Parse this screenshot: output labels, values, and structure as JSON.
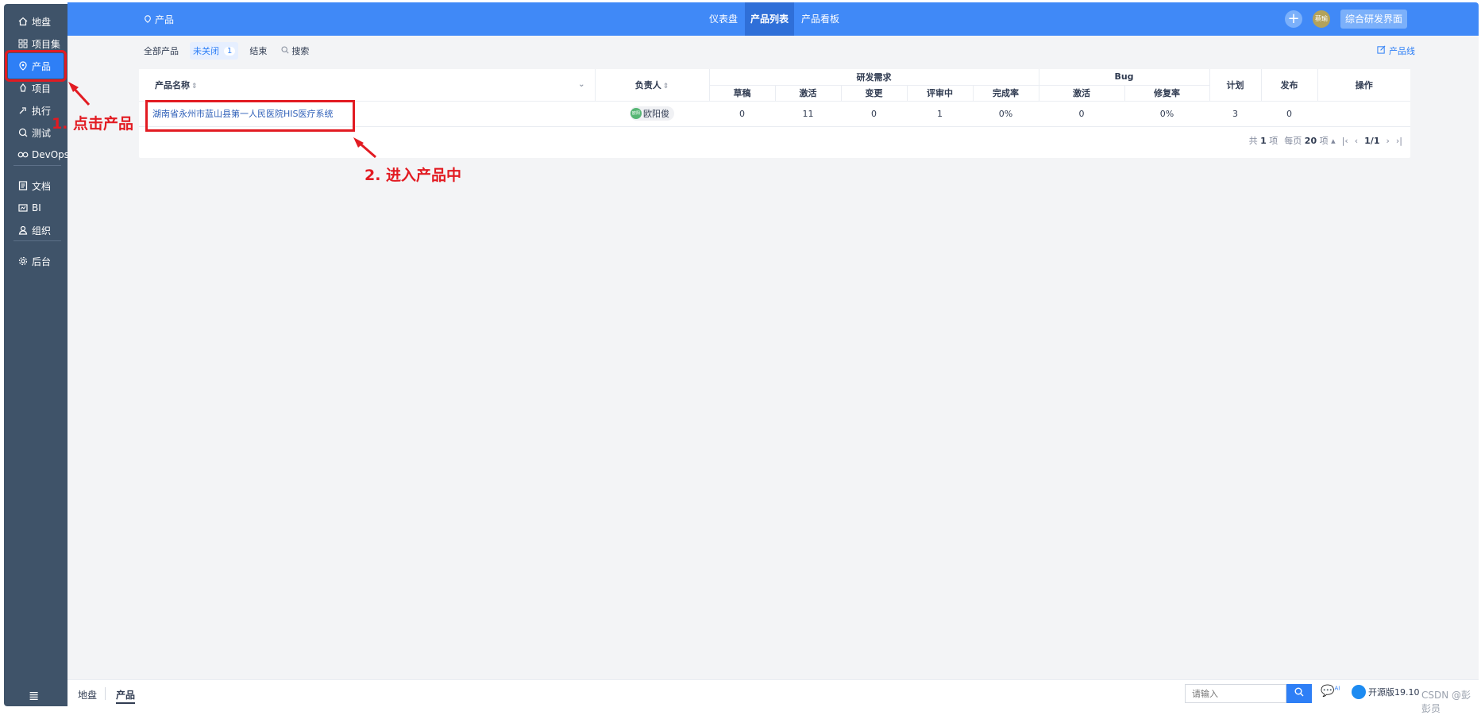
{
  "sidebar": {
    "items": [
      {
        "label": "地盘",
        "icon": "home-icon"
      },
      {
        "label": "项目集",
        "icon": "grid-icon"
      },
      {
        "label": "产品",
        "icon": "product-icon"
      },
      {
        "label": "项目",
        "icon": "project-icon"
      },
      {
        "label": "执行",
        "icon": "execute-icon"
      },
      {
        "label": "测试",
        "icon": "test-icon"
      },
      {
        "label": "DevOps",
        "icon": "infinity-icon"
      },
      {
        "label": "文档",
        "icon": "doc-icon"
      },
      {
        "label": "BI",
        "icon": "bi-icon"
      },
      {
        "label": "组织",
        "icon": "org-icon"
      },
      {
        "label": "后台",
        "icon": "gear-icon"
      }
    ],
    "collapse_icon": "menu-collapse-icon"
  },
  "header": {
    "breadcrumb": "产品",
    "tabs": [
      "仪表盘",
      "产品列表",
      "产品看板"
    ],
    "active_tab": "产品列表",
    "avatar_text": "蔡瑜",
    "ui_switch_label": "综合研发界面",
    "accent_color": "#4089f7"
  },
  "filters": {
    "all": "全部产品",
    "unclosed": "未关闭",
    "unclosed_count": "1",
    "closed": "结束",
    "search": "搜索",
    "product_line": "产品线"
  },
  "table": {
    "headers": {
      "name": "产品名称",
      "owner": "负责人",
      "requirements_group": "研发需求",
      "bug_group": "Bug",
      "plan": "计划",
      "release": "发布",
      "actions": "操作"
    },
    "sub_headers": {
      "draft": "草稿",
      "active": "激活",
      "changed": "变更",
      "reviewing": "评审中",
      "completion": "完成率",
      "bug_active": "激活",
      "fix_rate": "修复率"
    },
    "rows": [
      {
        "name": "湖南省永州市蓝山县第一人民医院HIS医疗系统",
        "owner": "欧阳俊",
        "owner_avatar": "欧阳",
        "draft": "0",
        "active": "11",
        "changed": "0",
        "reviewing": "1",
        "completion": "0%",
        "bug_active": "0",
        "fix_rate": "0%",
        "plan": "3",
        "release": "0"
      }
    ]
  },
  "pager": {
    "total_prefix": "共",
    "total": "1",
    "total_suffix": "项",
    "per_page_prefix": "每页",
    "per_page": "20",
    "per_page_suffix": "项",
    "page": "1/1"
  },
  "annotations": {
    "step1": "1. 点击产品",
    "step2": "2. 进入产品中",
    "color": "#e21b22"
  },
  "footer": {
    "crumbs": [
      "地盘",
      "产品"
    ],
    "search_placeholder": "请输入",
    "ai_label": "AI",
    "version": "开源版19.10",
    "watermark": "CSDN @彭彭员"
  }
}
